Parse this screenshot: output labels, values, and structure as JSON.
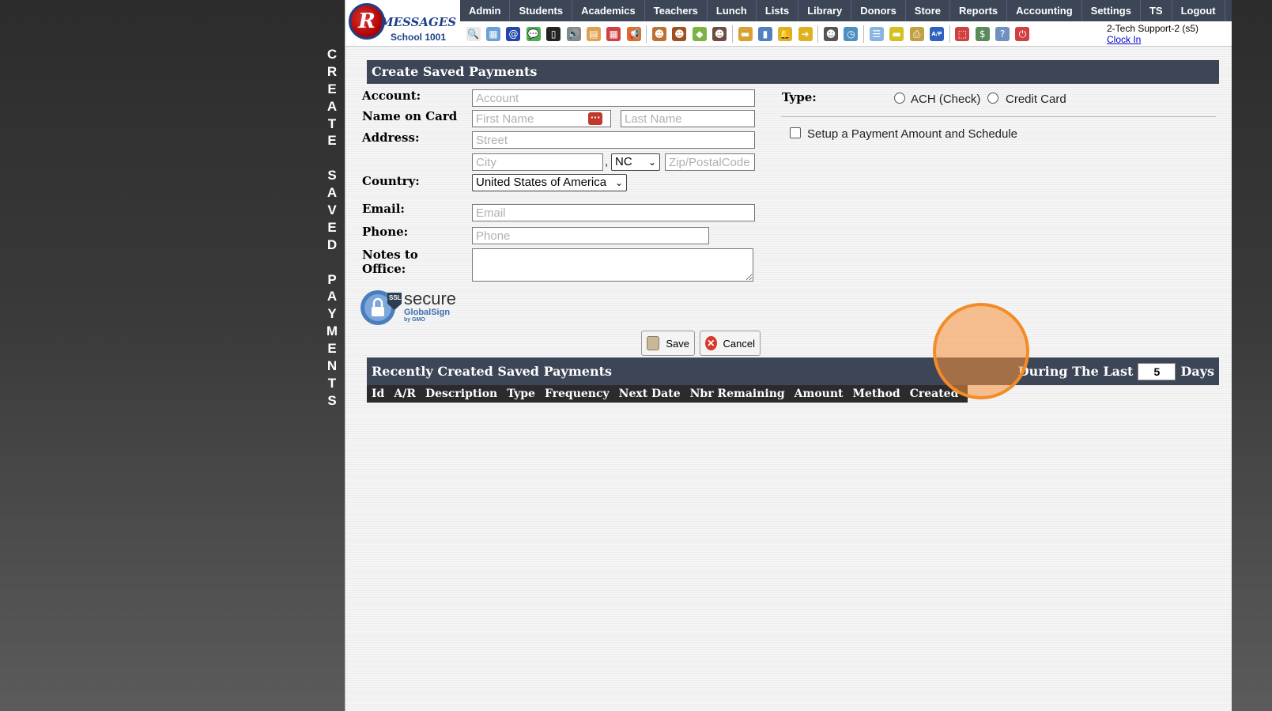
{
  "side_title": [
    "C",
    "R",
    "E",
    "A",
    "T",
    "E",
    " ",
    "S",
    "A",
    "V",
    "E",
    "D",
    " ",
    "P",
    "A",
    "Y",
    "M",
    "E",
    "N",
    "T",
    "S"
  ],
  "logo": {
    "letter": "R",
    "brand": "MESSAGES",
    "school": "School 1001"
  },
  "menu": [
    "Admin",
    "Students",
    "Academics",
    "Teachers",
    "Lunch",
    "Lists",
    "Library",
    "Donors",
    "Store",
    "Reports",
    "Accounting",
    "Settings",
    "TS",
    "Logout"
  ],
  "toolbar_icons": [
    {
      "name": "search-icon",
      "glyph": "🔍",
      "color": "#e8e8e8"
    },
    {
      "name": "table-icon",
      "glyph": "▦",
      "color": "#6aa0d8"
    },
    {
      "name": "email-icon",
      "glyph": "@",
      "color": "#2346a8"
    },
    {
      "name": "chat-icon",
      "glyph": "💬",
      "color": "#4caf50"
    },
    {
      "name": "mobile-icon",
      "glyph": "▯",
      "color": "#222"
    },
    {
      "name": "speaker-icon",
      "glyph": "🔊",
      "color": "#888"
    },
    {
      "name": "calendar-grid-icon",
      "glyph": "▤",
      "color": "#e0a050"
    },
    {
      "name": "calendar-icon",
      "glyph": "▦",
      "color": "#d04040"
    },
    {
      "name": "megaphone-icon",
      "glyph": "📢",
      "color": "#d87030"
    },
    {
      "name": "sep"
    },
    {
      "name": "person-icon",
      "glyph": "☻",
      "color": "#c07030"
    },
    {
      "name": "teacher-icon",
      "glyph": "☻",
      "color": "#a05020"
    },
    {
      "name": "eraser-icon",
      "glyph": "◆",
      "color": "#7cb342"
    },
    {
      "name": "group-icon",
      "glyph": "☻",
      "color": "#6d4c41"
    },
    {
      "name": "sep"
    },
    {
      "name": "food-icon",
      "glyph": "▬",
      "color": "#d8a030"
    },
    {
      "name": "book-icon",
      "glyph": "▮",
      "color": "#5080c0"
    },
    {
      "name": "bell-icon",
      "glyph": "🔔",
      "color": "#e0b020"
    },
    {
      "name": "export-icon",
      "glyph": "➜",
      "color": "#e0b020"
    },
    {
      "name": "sep"
    },
    {
      "name": "staff-icon",
      "glyph": "☻",
      "color": "#555"
    },
    {
      "name": "clock-icon",
      "glyph": "◷",
      "color": "#4a90c0"
    },
    {
      "name": "sep"
    },
    {
      "name": "list-icon",
      "glyph": "☰",
      "color": "#8ab4e0"
    },
    {
      "name": "card-icon",
      "glyph": "▬",
      "color": "#d4c020"
    },
    {
      "name": "printer-icon",
      "glyph": "⎙",
      "color": "#c0a040"
    },
    {
      "name": "ap-icon",
      "glyph": "A/P",
      "color": "#3060c0"
    },
    {
      "name": "sep"
    },
    {
      "name": "pdf-icon",
      "glyph": "⬚",
      "color": "#d04040"
    },
    {
      "name": "money-icon",
      "glyph": "$",
      "color": "#5a8a5a"
    },
    {
      "name": "help-icon",
      "glyph": "?",
      "color": "#7090c0"
    },
    {
      "name": "power-icon",
      "glyph": "⏻",
      "color": "#d04040"
    }
  ],
  "user": {
    "name": "2-Tech Support-2 (s5)",
    "clock_in": "Clock In"
  },
  "form": {
    "title": "Create Saved Payments",
    "account_label": "Account:",
    "account_placeholder": "Account",
    "name_label": "Name on Card",
    "first_placeholder": "First Name",
    "last_placeholder": "Last Name",
    "address_label": "Address:",
    "street_placeholder": "Street",
    "city_placeholder": "City",
    "comma": ",",
    "state_value": "NC",
    "zip_placeholder": "Zip/PostalCode",
    "country_label": "Country:",
    "country_value": "United States of America",
    "email_label": "Email:",
    "email_placeholder": "Email",
    "phone_label": "Phone:",
    "phone_placeholder": "Phone",
    "notes_label_1": "Notes to",
    "notes_label_2": "Office:",
    "type_label": "Type:",
    "type_ach": "ACH (Check)",
    "type_credit": "Credit Card",
    "schedule_label": "Setup a Payment Amount and Schedule",
    "save_label": "Save",
    "cancel_label": "Cancel"
  },
  "ssl_badge": {
    "tag": "SSL",
    "word": "secure",
    "brand": "GlobalSign",
    "by": "by GMO"
  },
  "recent": {
    "title": "Recently Created Saved Payments",
    "during": "During The Last",
    "days_value": "5",
    "days": "Days",
    "columns": [
      "Id",
      "A/R",
      "Description",
      "Type",
      "Frequency",
      "Next Date",
      "Nbr Remaining",
      "Amount",
      "Method",
      "Created"
    ]
  }
}
